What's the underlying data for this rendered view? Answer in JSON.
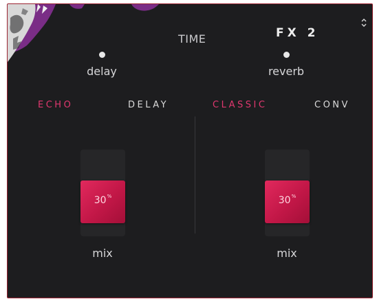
{
  "header": {
    "time_label": "TIME",
    "preset_name": "FX 2",
    "preset_switch_icon": "chevron-up-down-icon"
  },
  "left": {
    "param_label": "delay",
    "modes": [
      {
        "label": "ECHO",
        "active": true
      },
      {
        "label": "DELAY",
        "active": false
      }
    ],
    "mix": {
      "value": "30",
      "unit": "%",
      "fill_fraction": 0.3,
      "label": "mix"
    }
  },
  "right": {
    "param_label": "reverb",
    "modes": [
      {
        "label": "CLASSIC",
        "active": true
      },
      {
        "label": "CONV",
        "active": false
      }
    ],
    "mix": {
      "value": "30",
      "unit": "%",
      "fill_fraction": 0.3,
      "label": "mix"
    }
  },
  "colors": {
    "accent": "#e0386f",
    "thumb": "#c21747",
    "background": "#1d1d1f",
    "border": "#9b2230",
    "artwork_purple": "#7a2d86"
  }
}
